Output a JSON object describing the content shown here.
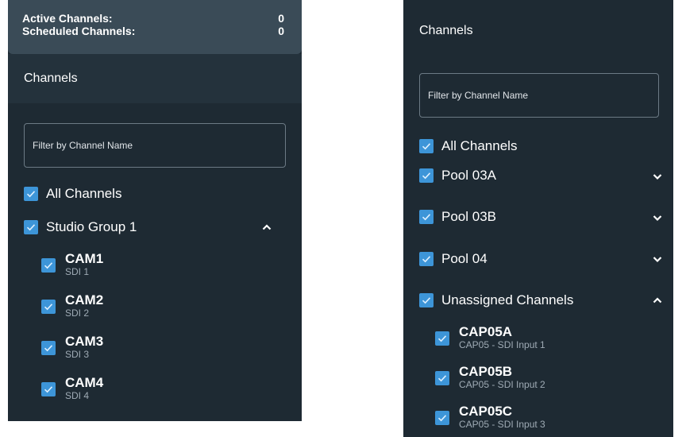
{
  "left": {
    "summary": {
      "active_label": "Active Channels:",
      "active_value": "0",
      "scheduled_label": "Scheduled Channels:",
      "scheduled_value": "0"
    },
    "header": "Channels",
    "filter_placeholder": "Filter by Channel Name",
    "all_channels": "All Channels",
    "group": "Studio Group 1",
    "channels": [
      {
        "name": "CAM1",
        "sub": "SDI 1"
      },
      {
        "name": "CAM2",
        "sub": "SDI 2"
      },
      {
        "name": "CAM3",
        "sub": "SDI 3"
      },
      {
        "name": "CAM4",
        "sub": "SDI 4"
      }
    ]
  },
  "right": {
    "header": "Channels",
    "filter_placeholder": "Filter by Channel Name",
    "all_channels": "All Channels",
    "groups": [
      {
        "label": "Pool 03A",
        "chevron": "chevron-down-icon"
      },
      {
        "label": "Pool 03B",
        "chevron": "chevron-down-icon"
      },
      {
        "label": "Pool 04",
        "chevron": "chevron-down-icon"
      },
      {
        "label": "Unassigned Channels",
        "chevron": "chevron-up-icon"
      }
    ],
    "channels": [
      {
        "name": "CAP05A",
        "sub": "CAP05 - SDI Input 1"
      },
      {
        "name": "CAP05B",
        "sub": "CAP05 - SDI Input 2"
      },
      {
        "name": "CAP05C",
        "sub": "CAP05 - SDI Input 3"
      }
    ]
  },
  "colors": {
    "panel_bg": "#1e2a33",
    "summary_bg": "#3a4b57",
    "header_bg": "#24323c",
    "checkbox": "#3d95d8",
    "subtext": "#9fabb5"
  }
}
